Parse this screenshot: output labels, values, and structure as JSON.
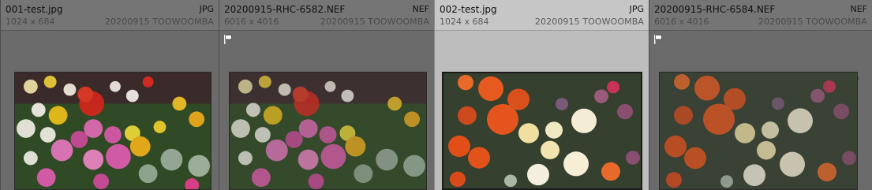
{
  "filmstrip": {
    "cells": [
      {
        "filename": "001-test.jpg",
        "type": "JPG",
        "dimensions": "1024 x 684",
        "metadata": "20200915 TOOWOOMBA",
        "flag": false,
        "selected": false,
        "variant": "pink-garden"
      },
      {
        "filename": "20200915-RHC-6582.NEF",
        "type": "NEF",
        "dimensions": "6016 x 4016",
        "metadata": "20200915 TOOWOOMBA",
        "flag": true,
        "selected": false,
        "variant": "pink-garden"
      },
      {
        "filename": "002-test.jpg",
        "type": "JPG",
        "dimensions": "1024 x 684",
        "metadata": "20200915 TOOWOOMBA",
        "flag": false,
        "selected": true,
        "variant": "orange-ranunculus"
      },
      {
        "filename": "20200915-RHC-6584.NEF",
        "type": "NEF",
        "dimensions": "6016 x 4016",
        "metadata": "20200915 TOOWOOMBA",
        "flag": true,
        "selected": false,
        "variant": "orange-ranunculus"
      }
    ]
  },
  "icons": {
    "flag": "flag-icon",
    "badge": "status-circle-icon"
  },
  "colors": {
    "panel_bg": "#6b6b6b",
    "selected_bg": "#bdbdbd",
    "header_text": "#111111",
    "meta_text": "#4a4a4a"
  }
}
